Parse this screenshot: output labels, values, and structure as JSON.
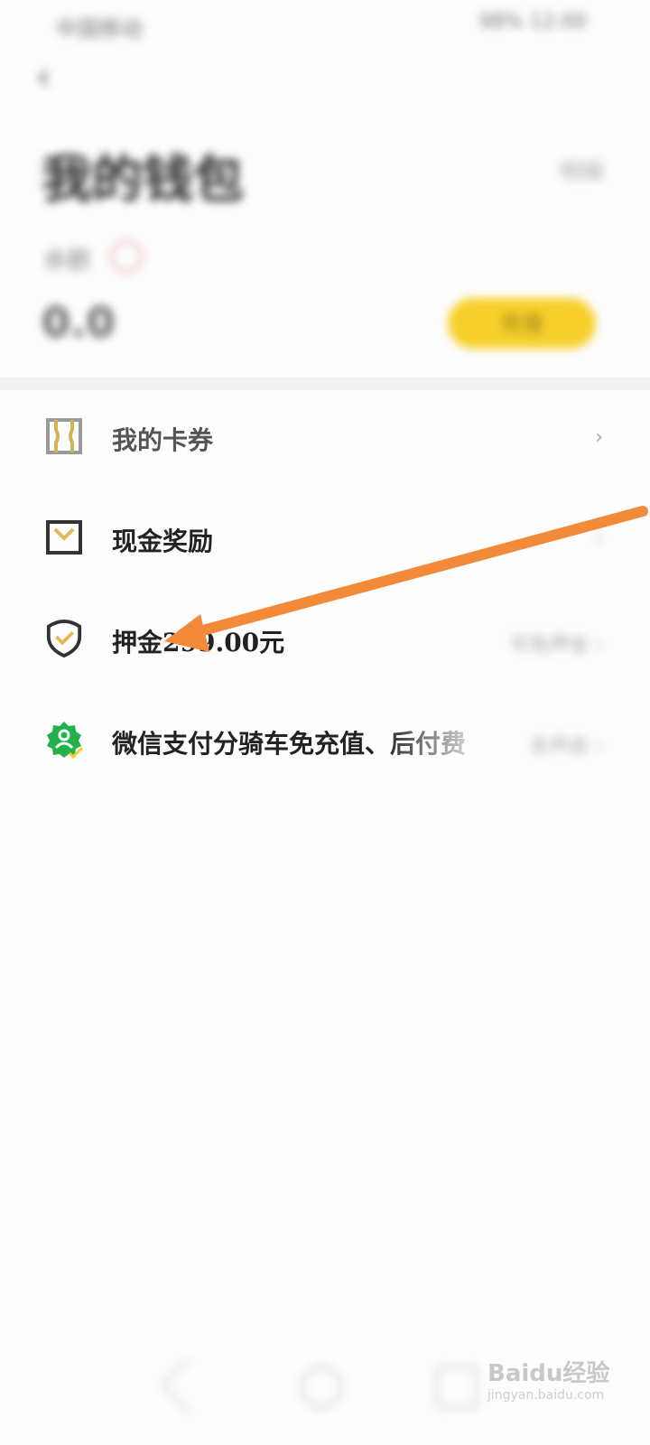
{
  "status_bar": {
    "left_text": "中国移动",
    "right_text": "98% 12:00"
  },
  "header": {
    "back_icon": "chevron-left-icon",
    "title": "我的钱包",
    "detail_link": "明细",
    "balance_label": "余额",
    "balance_value": "0.0",
    "recharge_button": "充值"
  },
  "menu": {
    "items": [
      {
        "icon": "ticket-icon",
        "label": "我的卡券",
        "right": ""
      },
      {
        "icon": "envelope-icon",
        "label": "现金奖励",
        "right": ""
      },
      {
        "icon": "shield-check-icon",
        "label": "押金299.00元",
        "right": "可免押金 ›"
      },
      {
        "icon": "wechat-pay-badge-icon",
        "label": "微信支付分骑车免充值、后付费",
        "right": "去开启 ›"
      }
    ]
  },
  "watermark": {
    "logo": "Baidu经验",
    "site": "jingyan.baidu.com"
  },
  "colors": {
    "accent_yellow": "#f7d02b",
    "annotation_orange": "#f38a3a",
    "wechat_green": "#21b24b"
  }
}
